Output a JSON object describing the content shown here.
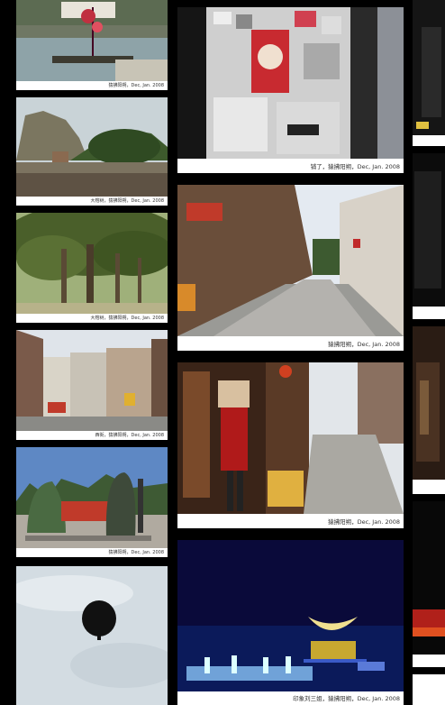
{
  "photos": {
    "left_1": {
      "caption": "猿拂阳朔，Dec, Jan. 2008",
      "subject": "river-bamboo-raft"
    },
    "left_2": {
      "caption": "大榕树，猿拂阳朔，Dec, Jan. 2008",
      "subject": "karst-river-trees"
    },
    "left_3": {
      "caption": "大榕树，猿拂阳朔，Dec, Jan. 2008",
      "subject": "banyan-tree"
    },
    "left_4": {
      "caption": "西街，猿拂阳朔，Dec, Jan. 2008",
      "subject": "west-street-buildings"
    },
    "left_5": {
      "caption": "猿拂阳朔，Dec, Jan. 2008",
      "subject": "stone-monuments"
    },
    "left_6": {
      "caption": "",
      "subject": "hot-air-balloon"
    },
    "center_1": {
      "caption": "铺了，猿拂阳朔，Dec, Jan. 2008",
      "subject": "poster-wall"
    },
    "center_2": {
      "caption": "猿拂阳朔，Dec, Jan. 2008",
      "subject": "old-street"
    },
    "center_3": {
      "caption": "猿拂阳朔，Dec, Jan. 2008",
      "subject": "costume-shop-street"
    },
    "center_4": {
      "caption": "印象刘三姐，猿拂阳朔，Dec, Jan. 2008",
      "subject": "night-show"
    },
    "right_strip": {
      "caption": "",
      "subject": "partial-column"
    }
  },
  "colors": {
    "background": "#000000",
    "card": "#ffffff",
    "sky": "#dfe6ec",
    "night": "#0a0a3a"
  }
}
